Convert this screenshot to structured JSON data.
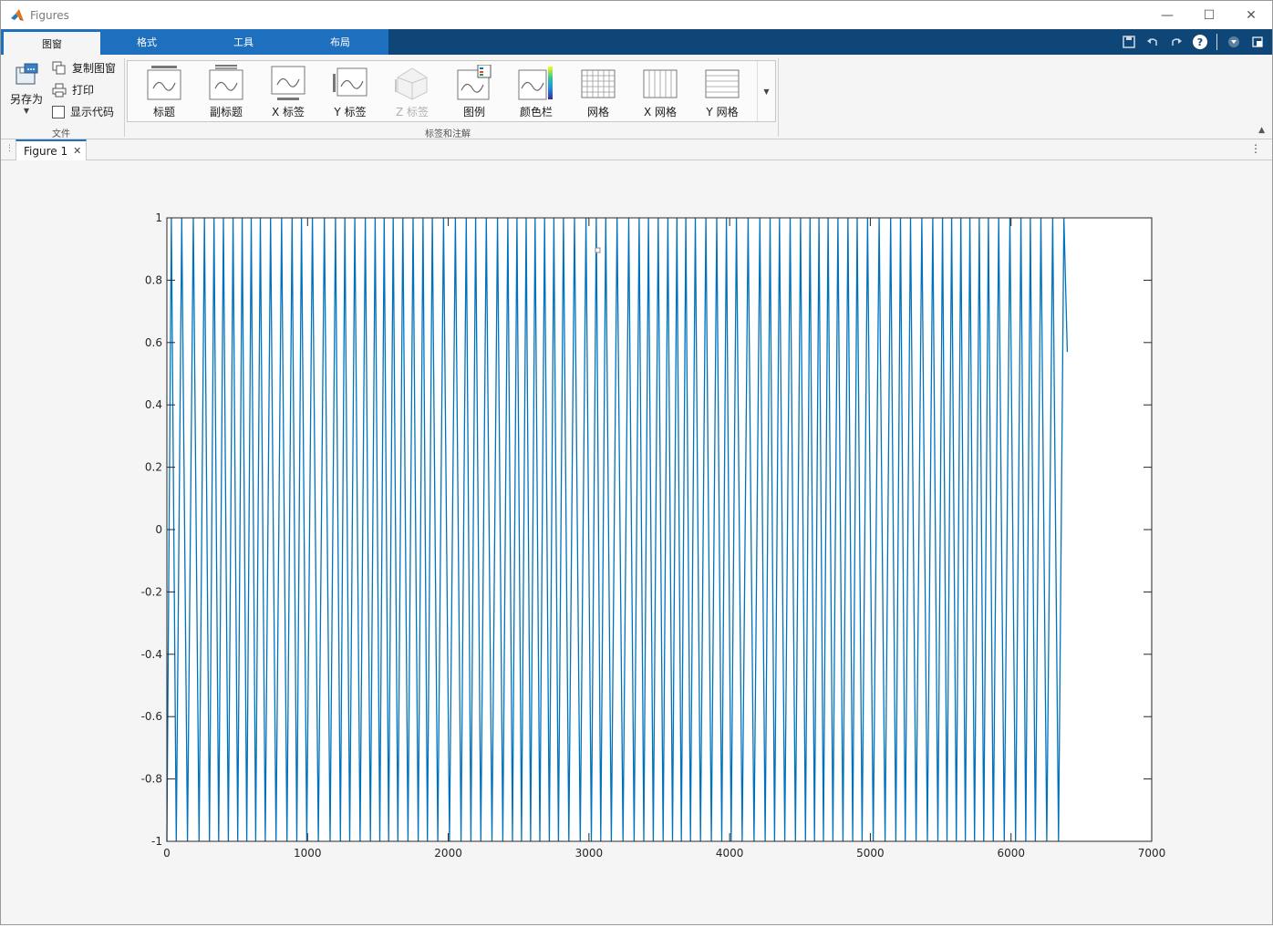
{
  "window": {
    "title": "Figures"
  },
  "window_controls": {
    "minimize": "—",
    "maximize": "☐",
    "close": "✕"
  },
  "tabs": [
    {
      "label": "图窗",
      "active": true
    },
    {
      "label": "格式",
      "active": false
    },
    {
      "label": "工具",
      "active": false
    },
    {
      "label": "布局",
      "active": false
    }
  ],
  "quick_access": {
    "help": "?"
  },
  "file_group": {
    "save_as": "另存为",
    "copy_figure": "复制图窗",
    "print": "打印",
    "show_code": "显示代码",
    "label": "文件"
  },
  "labels_group": {
    "items": [
      {
        "label": "标题",
        "icon": "title-icon"
      },
      {
        "label": "副标题",
        "icon": "subtitle-icon"
      },
      {
        "label": "X 标签",
        "icon": "xlabel-icon"
      },
      {
        "label": "Y 标签",
        "icon": "ylabel-icon"
      },
      {
        "label": "Z 标签",
        "icon": "zlabel-icon",
        "disabled": true
      },
      {
        "label": "图例",
        "icon": "legend-icon"
      },
      {
        "label": "颜色栏",
        "icon": "colorbar-icon"
      },
      {
        "label": "网格",
        "icon": "grid-icon"
      },
      {
        "label": "X 网格",
        "icon": "xgrid-icon"
      },
      {
        "label": "Y 网格",
        "icon": "ygrid-icon"
      }
    ],
    "label": "标签和注解"
  },
  "document": {
    "tab_label": "Figure 1",
    "close": "✕"
  },
  "chart_data": {
    "type": "line",
    "title": "",
    "xlabel": "",
    "ylabel": "",
    "xlim": [
      0,
      7000
    ],
    "ylim": [
      -1,
      1
    ],
    "xticks": [
      0,
      1000,
      2000,
      3000,
      4000,
      5000,
      6000,
      7000
    ],
    "yticks": [
      -1,
      -0.8,
      -0.6,
      -0.4,
      -0.2,
      0,
      0.2,
      0.4,
      0.6,
      0.8,
      1
    ],
    "ytick_labels": [
      "-1",
      "-0.8",
      "-0.6",
      "-0.4",
      "-0.2",
      "0",
      "0.2",
      "0.4",
      "0.6",
      "0.8",
      "1"
    ],
    "grid": false,
    "series": [
      {
        "color": "#0072BD",
        "description_of_shape": "triangle wave oscillating between -1 and 1 with roughly 65-80 sample period, ending near x=6400 at y=0.57",
        "x_end": 6400,
        "y_end": 0.57,
        "period": 74
      }
    ]
  }
}
